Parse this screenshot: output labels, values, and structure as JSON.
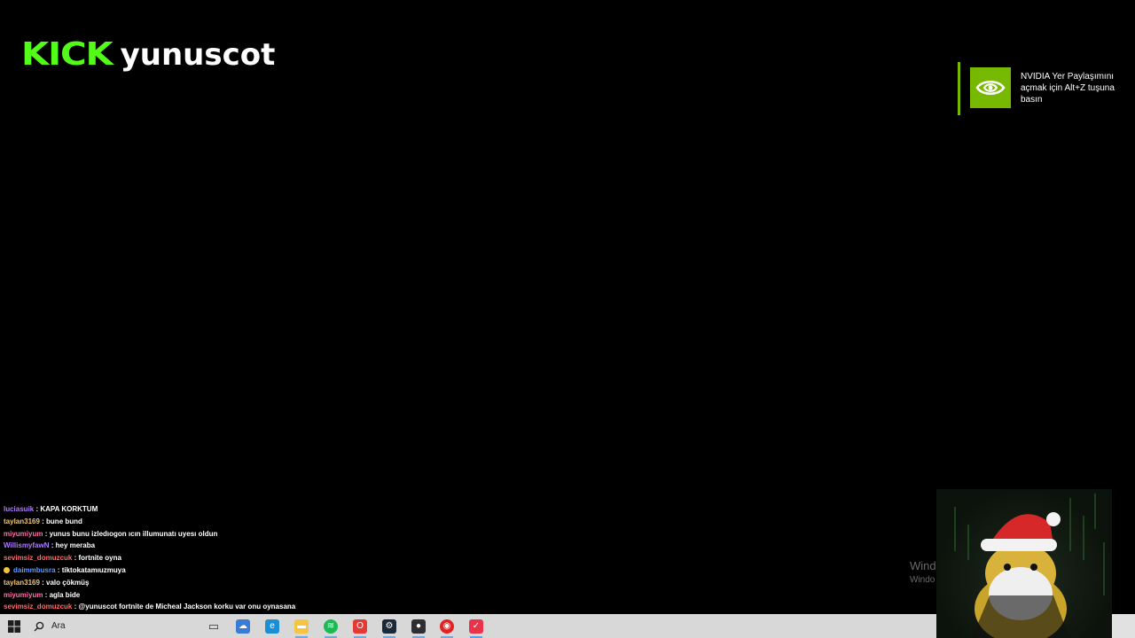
{
  "stream": {
    "platform_logo": "KICK",
    "username": "yunuscot",
    "brand_color": "#53fc18"
  },
  "nvidia_toast": {
    "message": "NVIDIA Yer Paylaşımını açmak için Alt+Z tuşuna basın",
    "accent_color": "#76b900",
    "icon": "nvidia-eye-icon"
  },
  "chat": {
    "messages": [
      {
        "user": "luciasuik",
        "text": "KAPA KORKTUM",
        "color": "#b07cff"
      },
      {
        "user": "taylan3169",
        "text": "bune bund",
        "color": "#f0c674"
      },
      {
        "user": "miyumiyum",
        "text": "yunus bunu izledıogon ıcın illumunatı uyesı oldun",
        "color": "#ff6fa8"
      },
      {
        "user": "WillismyfawN",
        "text": "hey meraba",
        "color": "#b07cff"
      },
      {
        "user": "sevimsiz_domuzcuk",
        "text": "fortnite oyna",
        "color": "#ff6b6b"
      },
      {
        "user": "daimmbusra",
        "text": "tiktokatamıuzmuya",
        "color": "#5b9bff",
        "badge": true
      },
      {
        "user": "taylan3169",
        "text": "valo çökmüş",
        "color": "#f0c674"
      },
      {
        "user": "miyumiyum",
        "text": "agla bide",
        "color": "#ff6fa8"
      },
      {
        "user": "sevimsiz_domuzcuk",
        "text": "@yunuscot fortnite de Micheal Jackson korku var onu oynasana",
        "color": "#ff6b6b"
      }
    ]
  },
  "watermark": {
    "line1": "Windo",
    "line2": "Windo"
  },
  "taskbar": {
    "search_label": "Ara",
    "apps": [
      {
        "name": "task-view-icon",
        "color": "#555"
      },
      {
        "name": "weather-icon",
        "color": "#3a7bd5"
      },
      {
        "name": "edge-icon",
        "color": "#1b8fd6"
      },
      {
        "name": "file-explorer-icon",
        "color": "#f5c542"
      },
      {
        "name": "spotify-icon",
        "color": "#1db954"
      },
      {
        "name": "opera-icon",
        "color": "#e53935"
      },
      {
        "name": "steam-icon",
        "color": "#1b2838"
      },
      {
        "name": "obs-icon",
        "color": "#302e31"
      },
      {
        "name": "red-app-icon",
        "color": "#e02424"
      },
      {
        "name": "kick-studio-icon",
        "color": "#e8334a"
      }
    ]
  }
}
